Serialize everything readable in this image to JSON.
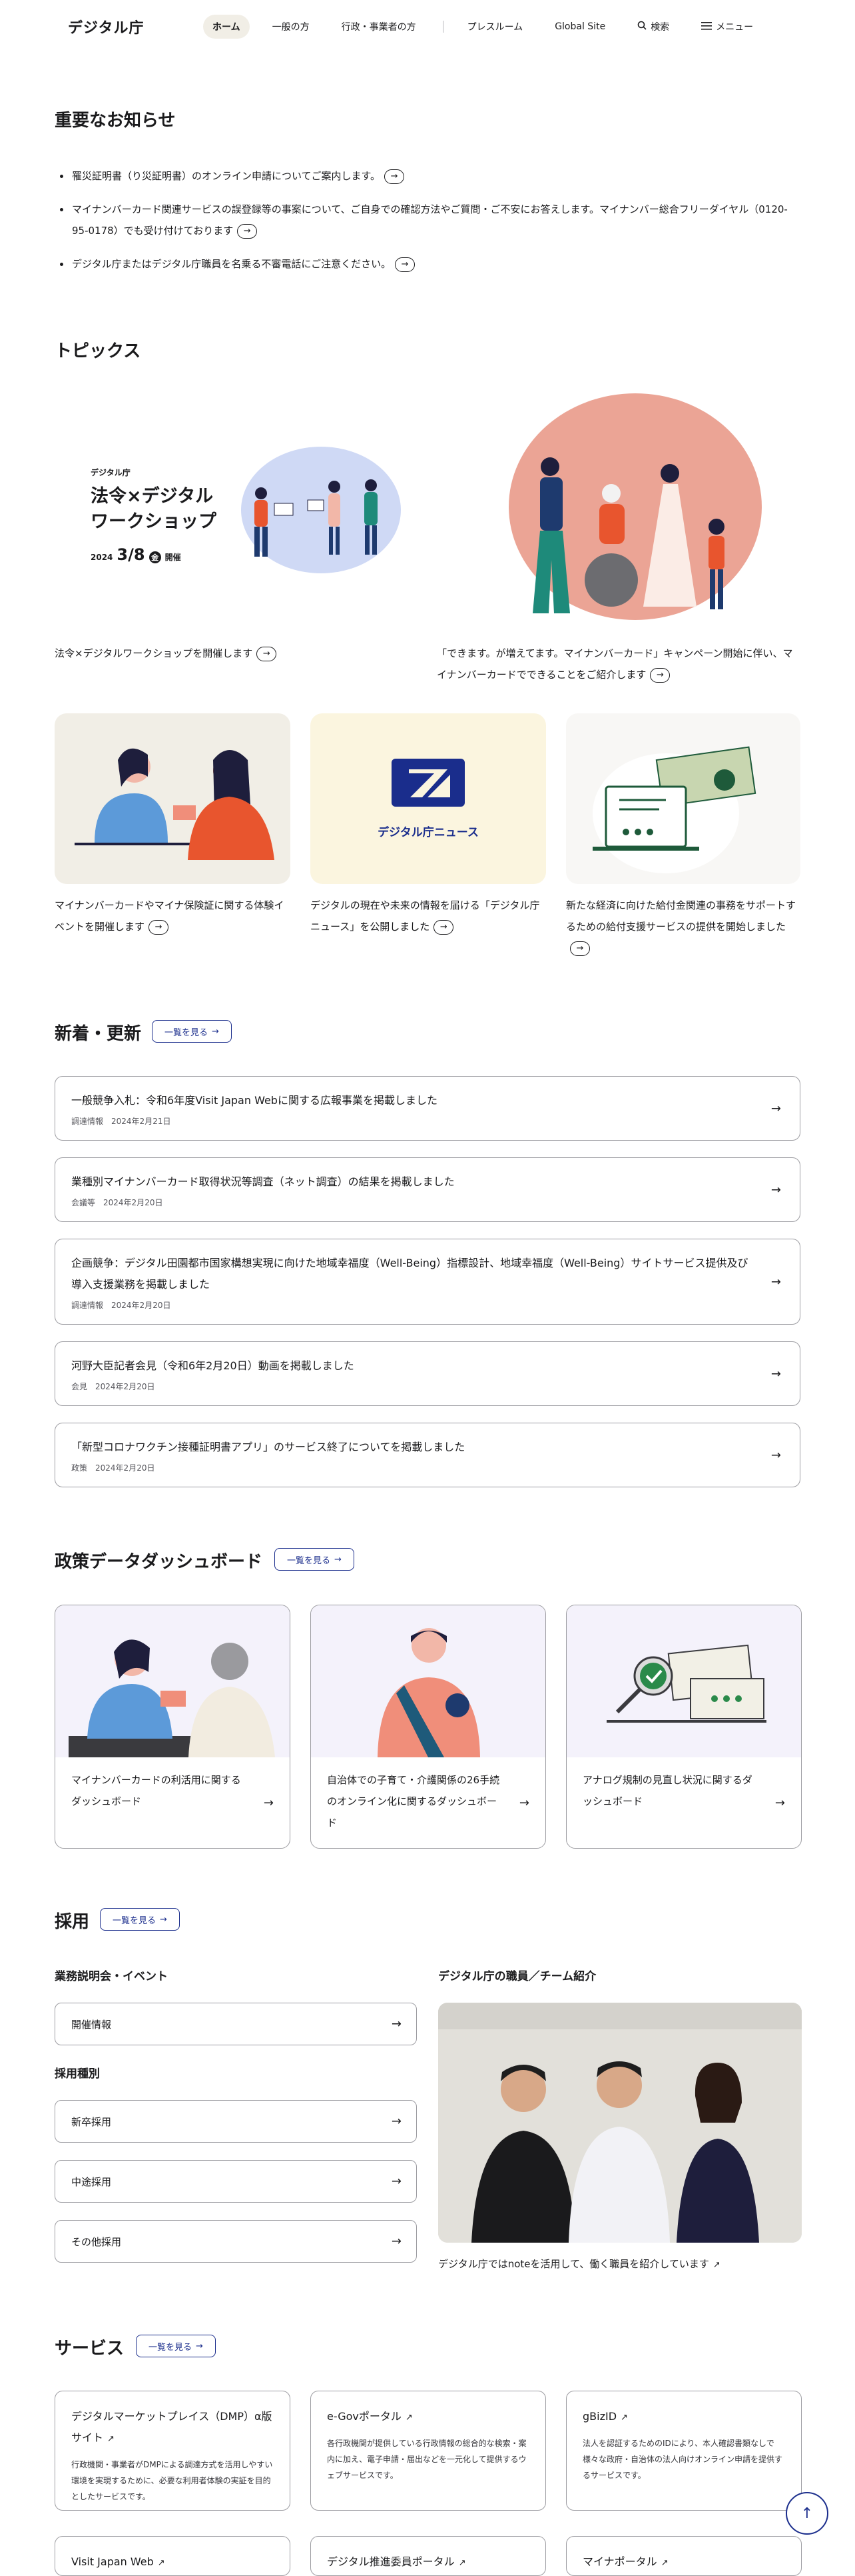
{
  "header": {
    "logo": "デジタル庁",
    "nav": [
      "ホーム",
      "一般の方",
      "行政・事業者の方",
      "プレスルーム",
      "Global Site",
      "検索",
      "メニュー"
    ]
  },
  "notices": {
    "title": "重要なお知らせ",
    "items": [
      "罹災証明書（り災証明書）のオンライン申請についてご案内します。",
      "マイナンバーカード関連サービスの誤登録等の事案について、ご自身での確認方法やご質問・ご不安にお答えします。マイナンバー総合フリーダイヤル（0120-95-0178）でも受け付けております",
      "デジタル庁またはデジタル庁職員を名乗る不審電話にご注意ください。"
    ]
  },
  "topics": {
    "title": "トピックス",
    "banner": {
      "org": "デジタル庁",
      "heading": "法令×デジタル ワークショップ",
      "year": "2024",
      "date": "3/8",
      "weekday": "金",
      "suffix": "開催"
    },
    "items": [
      "法令×デジタルワークショップを開催します",
      "「できます。が増えてます。マイナンバーカード」キャンペーン開始に伴い、マイナンバーカードでできることをご紹介します",
      "マイナンバーカードやマイナ保険証に関する体験イベントを開催します",
      "デジタルの現在や未来の情報を届ける「デジタル庁ニュース」を公開しました",
      "新たな経済に向けた給付金関連の事務をサポートするための給付支援サービスの提供を開始しました"
    ],
    "news_logo_text": "デジタル庁ニュース"
  },
  "news": {
    "title": "新着・更新",
    "more": "一覧を見る",
    "items": [
      {
        "title": "一般競争入札：令和6年度Visit Japan Webに関する広報事業を掲載しました",
        "cat": "調達情報",
        "date": "2024年2月21日"
      },
      {
        "title": "業種別マイナンバーカード取得状況等調査（ネット調査）の結果を掲載しました",
        "cat": "会議等",
        "date": "2024年2月20日"
      },
      {
        "title": "企画競争：デジタル田園都市国家構想実現に向けた地域幸福度（Well-Being）指標設計、地域幸福度（Well-Being）サイトサービス提供及び導入支援業務を掲載しました",
        "cat": "調達情報",
        "date": "2024年2月20日"
      },
      {
        "title": "河野大臣記者会見（令和6年2月20日）動画を掲載しました",
        "cat": "会見",
        "date": "2024年2月20日"
      },
      {
        "title": "「新型コロナワクチン接種証明書アプリ」のサービス終了についてを掲載しました",
        "cat": "政策",
        "date": "2024年2月20日"
      }
    ]
  },
  "dashboard": {
    "title": "政策データダッシュボード",
    "more": "一覧を見る",
    "items": [
      "マイナンバーカードの利活用に関するダッシュボード",
      "自治体での子育て・介護関係の26手続のオンライン化に関するダッシュボード",
      "アナログ規制の見直し状況に関するダッシュボード"
    ]
  },
  "recruit": {
    "title": "採用",
    "more": "一覧を見る",
    "events_title": "業務説明会・イベント",
    "events_btn": "開催情報",
    "types_title": "採用種別",
    "types": [
      "新卒採用",
      "中途採用",
      "その他採用"
    ],
    "staff_title": "デジタル庁の職員／チーム紹介",
    "staff_caption": "デジタル庁ではnoteを活用して、働く職員を紹介しています"
  },
  "services": {
    "title": "サービス",
    "more": "一覧を見る",
    "items": [
      {
        "title": "デジタルマーケットプレイス（DMP）α版サイト",
        "desc": "行政機関・事業者がDMPによる調達方式を活用しやすい環境を実現するために、必要な利用者体験の実証を目的としたサービスです。"
      },
      {
        "title": "e-Govポータル",
        "desc": "各行政機関が提供している行政情報の総合的な検索・案内に加え、電子申請・届出などを一元化して提供するウェブサービスです。"
      },
      {
        "title": "gBizID",
        "desc": "法人を認証するためのIDにより、本人確認書類なしで様々な政府・自治体の法人向けオンライン申請を提供するサービスです。"
      },
      {
        "title": "Visit Japan Web",
        "desc": ""
      },
      {
        "title": "デジタル推進委員ポータル",
        "desc": ""
      },
      {
        "title": "マイナポータル",
        "desc": ""
      }
    ]
  },
  "colors": {
    "accent": "#1a2d8c",
    "border": "#9c9ca1",
    "bg_beige": "#f1eee6"
  }
}
